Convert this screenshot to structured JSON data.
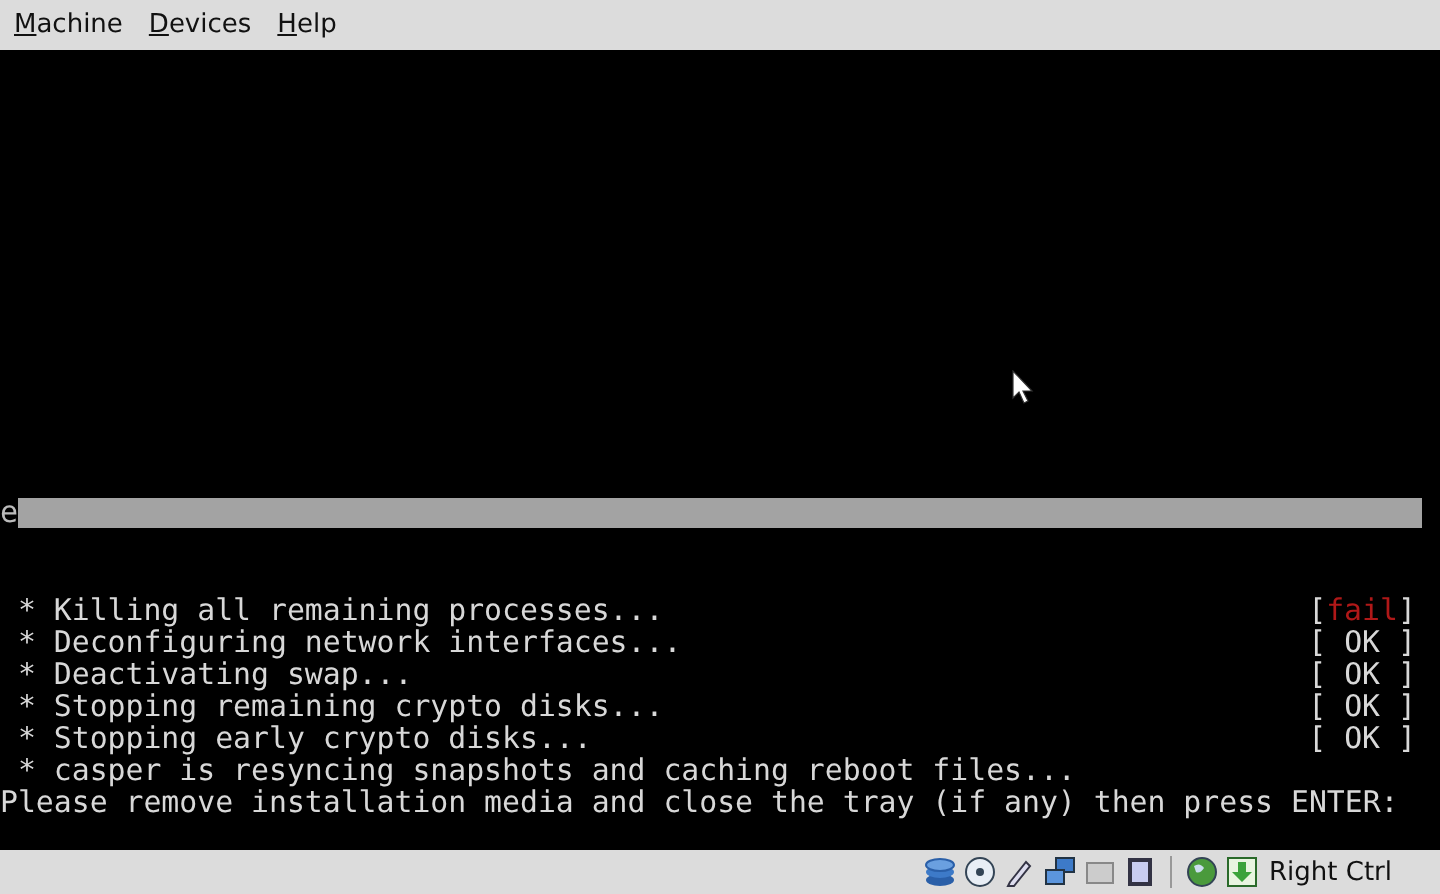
{
  "menu": [
    {
      "label": "Machine"
    },
    {
      "label": "Devices"
    },
    {
      "label": "Help"
    }
  ],
  "console": {
    "bar_text": "e",
    "lines": [
      {
        "text": " * Killing all remaining processes...",
        "status": {
          "open": "[",
          "word": "fail",
          "close": "]",
          "kind": "fail"
        }
      },
      {
        "text": " * Deconfiguring network interfaces...",
        "status": {
          "open": "[",
          "word": "OK",
          "close": "]",
          "kind": "ok"
        }
      },
      {
        "text": " * Deactivating swap...",
        "status": {
          "open": "[",
          "word": "OK",
          "close": "]",
          "kind": "ok"
        }
      },
      {
        "text": " * Stopping remaining crypto disks...",
        "status": {
          "open": "[",
          "word": "OK",
          "close": "]",
          "kind": "ok"
        }
      },
      {
        "text": " * Stopping early crypto disks...",
        "status": {
          "open": "[",
          "word": "OK",
          "close": "]",
          "kind": "ok"
        }
      },
      {
        "text": " * casper is resyncing snapshots and caching reboot files..."
      },
      {
        "text": "Please remove installation media and close the tray (if any) then press ENTER:"
      }
    ]
  },
  "status_bar": {
    "host_key": "Right Ctrl"
  }
}
